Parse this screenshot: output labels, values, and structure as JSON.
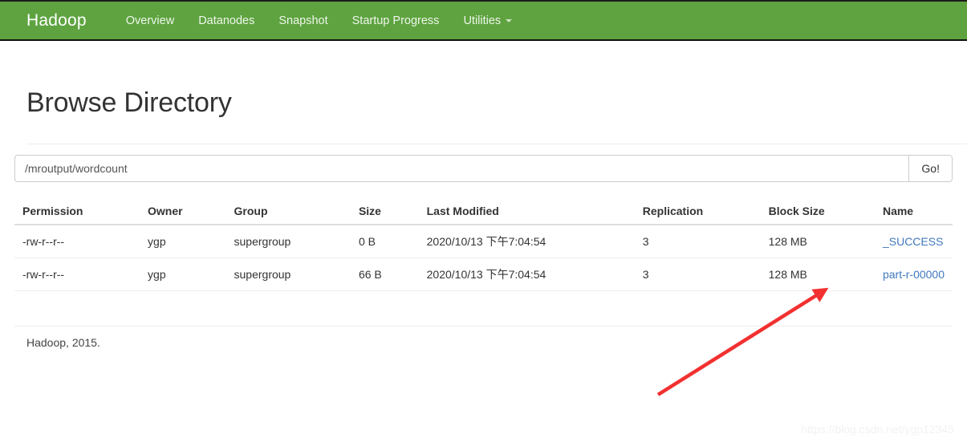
{
  "navbar": {
    "brand": "Hadoop",
    "links": [
      {
        "label": "Overview",
        "has_caret": false
      },
      {
        "label": "Datanodes",
        "has_caret": false
      },
      {
        "label": "Snapshot",
        "has_caret": false
      },
      {
        "label": "Startup Progress",
        "has_caret": false
      },
      {
        "label": "Utilities",
        "has_caret": true
      }
    ],
    "background_color": "#5ea340"
  },
  "page": {
    "title": "Browse Directory"
  },
  "path_bar": {
    "value": "/mroutput/wordcount",
    "placeholder": "Enter path",
    "go_label": "Go!"
  },
  "table": {
    "columns": [
      "Permission",
      "Owner",
      "Group",
      "Size",
      "Last Modified",
      "Replication",
      "Block Size",
      "Name"
    ],
    "rows": [
      {
        "permission": "-rw-r--r--",
        "owner": "ygp",
        "group": "supergroup",
        "size": "0 B",
        "last_modified": "2020/10/13 下午7:04:54",
        "replication": "3",
        "block_size": "128 MB",
        "name": "_SUCCESS"
      },
      {
        "permission": "-rw-r--r--",
        "owner": "ygp",
        "group": "supergroup",
        "size": "66 B",
        "last_modified": "2020/10/13 下午7:04:54",
        "replication": "3",
        "block_size": "128 MB",
        "name": "part-r-00000"
      }
    ],
    "link_color": "#4178be"
  },
  "footer": {
    "text": "Hadoop, 2015."
  },
  "annotation": {
    "arrow_color": "#f23030"
  },
  "watermark": {
    "text": "https://blog.csdn.net/ygp12345"
  }
}
